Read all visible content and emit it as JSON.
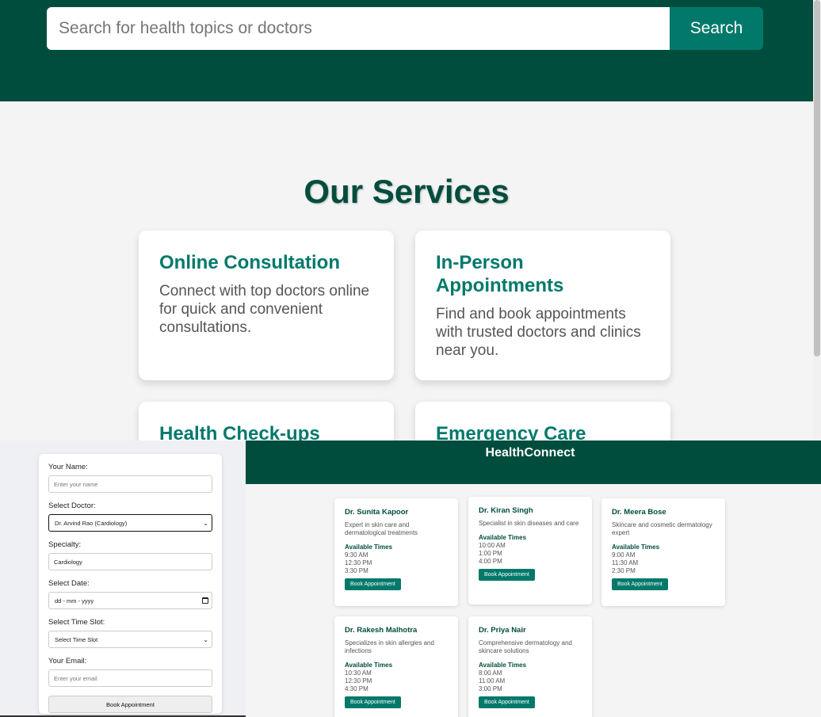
{
  "search": {
    "placeholder": "Search for health topics or doctors",
    "button_label": "Search"
  },
  "services": {
    "title": "Our Services",
    "cards": [
      {
        "title": "Online Consultation",
        "text": "Connect with top doctors online for quick and convenient consultations."
      },
      {
        "title": "In-Person Appointments",
        "text": "Find and book appointments with trusted doctors and clinics near you."
      },
      {
        "title": "Health Check-ups",
        "text": ""
      },
      {
        "title": "Emergency Care",
        "text": ""
      }
    ]
  },
  "form": {
    "name_label": "Your Name:",
    "name_placeholder": "Enter your name",
    "doctor_label": "Select Doctor:",
    "doctor_value": "Dr. Arvind Rao (Cardiology)",
    "specialty_label": "Specialty:",
    "specialty_value": "Cardiology",
    "date_label": "Select Date:",
    "date_value": "dd - mm - yyyy",
    "time_label": "Select Time Slot:",
    "time_value": "Select Time Slot",
    "email_label": "Your Email:",
    "email_placeholder": "Enter your email",
    "submit_label": "Book Appointment"
  },
  "doctors_panel": {
    "title": "HealthConnect",
    "available_label": "Available Times",
    "book_label": "Book Appointment",
    "doctors": [
      {
        "name": "Dr. Sunita Kapoor",
        "desc": "Expert in skin care and dermatological treatments",
        "times": [
          "9:30 AM",
          "12:30 PM",
          "3:30 PM"
        ]
      },
      {
        "name": "Dr. Kiran Singh",
        "desc": "Specialist in skin diseases and care",
        "times": [
          "10:00 AM",
          "1:00 PM",
          "4:00 PM"
        ]
      },
      {
        "name": "Dr. Meera Bose",
        "desc": "Skincare and cosmetic dermatology expert",
        "times": [
          "9:00 AM",
          "11:30 AM",
          "2:30 PM"
        ]
      },
      {
        "name": "Dr. Rakesh Malhotra",
        "desc": "Specializes in skin allergies and infections",
        "times": [
          "10:30 AM",
          "12:30 PM",
          "4:30 PM"
        ]
      },
      {
        "name": "Dr. Priya Nair",
        "desc": "Comprehensive dermatology and skincare solutions",
        "times": [
          "8:00 AM",
          "11:00 AM",
          "3:00 PM"
        ]
      }
    ]
  },
  "colors": {
    "brand_dark": "#004d3d",
    "accent": "#00796b"
  }
}
